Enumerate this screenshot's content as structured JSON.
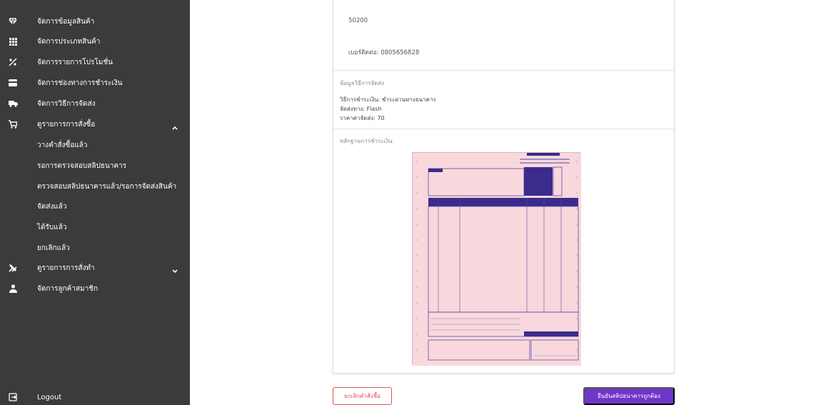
{
  "sidebar": {
    "items": [
      {
        "label": "จัดการข้อมูลสินค้า",
        "icon": "diamond-icon"
      },
      {
        "label": "จัดการประเภทสินค้า",
        "icon": "grid-icon"
      },
      {
        "label": "จัดการรายการโปรโมชั่น",
        "icon": "discount-icon"
      },
      {
        "label": "จัดการช่องทางการชำระเงิน",
        "icon": "credit-card-icon"
      },
      {
        "label": "จัดการวิธีการจัดส่ง",
        "icon": "truck-icon"
      },
      {
        "label": "ดูรายการการสั่งซื้อ",
        "icon": "cart-icon"
      },
      {
        "label": "ดูรายการการสั่งทำ",
        "icon": "tools-icon"
      },
      {
        "label": "จัดการลูกค้าสมาชิก",
        "icon": "person-icon"
      }
    ],
    "order_subitems": [
      "วางคำสั่งซื้อแล้ว",
      "รอการตรวจสอบสลิปธนาคาร",
      "ตรวจสอบสลิปธนาคารแล้ว/รอการจัดส่งสินค้า",
      "จัดส่งแล้ว",
      "ได้รับแล้ว",
      "ยกเลิกแล้ว"
    ],
    "logout_label": "Logout"
  },
  "order": {
    "postal_code": "50200",
    "phone_line": "เบอร์ติดต่อ: 0805656828",
    "shipping_section_title": "ข้อมูลวิธีการจัดส่ง",
    "payment_method_line": "วิธีการชำระเงิน: ชำระผ่านทางธนาคาร",
    "carrier_line": "จัดส่งทาง: Flash",
    "shipping_fee_line": "ราคาค่าจัดส่ง: 70",
    "proof_section_title": "หลักฐานการชำระเงิน"
  },
  "actions": {
    "cancel_label": "ยกเลิกคำสั่งซื้อ",
    "confirm_label": "ยืนยันสลิปธนาคารถูกต้อง"
  },
  "colors": {
    "sidebar_bg": "#3b3b3b",
    "confirm_bg": "#6f37c9",
    "cancel_border": "#d9534f",
    "slip_bg": "#f8d8dc",
    "slip_header": "#3b2b8c"
  }
}
